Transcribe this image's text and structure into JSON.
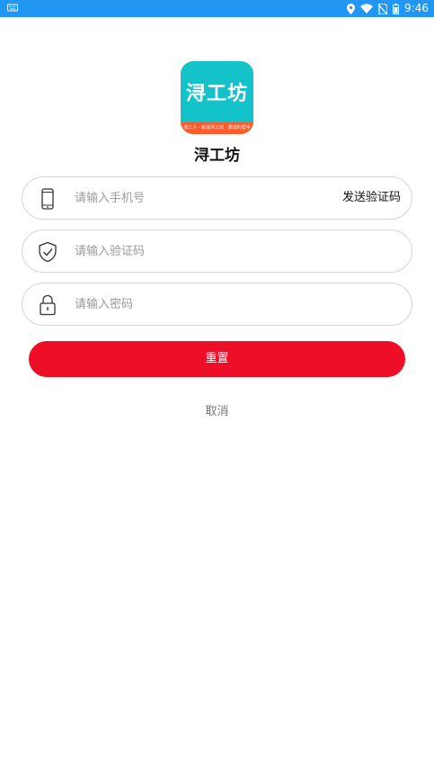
{
  "status_bar": {
    "time": "9:46",
    "left_icon": "keyboard-icon",
    "icons": [
      "location-icon",
      "wifi-icon",
      "no-sim-icon",
      "battery-icon"
    ],
    "background": "#2196f3"
  },
  "logo": {
    "text": "浔工坊",
    "tagline": "找工人 · 就找浔工坊 · 靠谱的帮手",
    "background": "#14c3ca",
    "band_color": "#ff5a2a"
  },
  "app_name": "浔工坊",
  "form": {
    "phone": {
      "placeholder": "请输入手机号",
      "icon": "phone-icon",
      "action": "发送验证码"
    },
    "code": {
      "placeholder": "请输入验证码",
      "icon": "shield-check-icon"
    },
    "password": {
      "placeholder": "请输入密码",
      "icon": "lock-icon"
    }
  },
  "buttons": {
    "reset": "重置",
    "reset_color": "#ef0e28",
    "cancel": "取消"
  }
}
